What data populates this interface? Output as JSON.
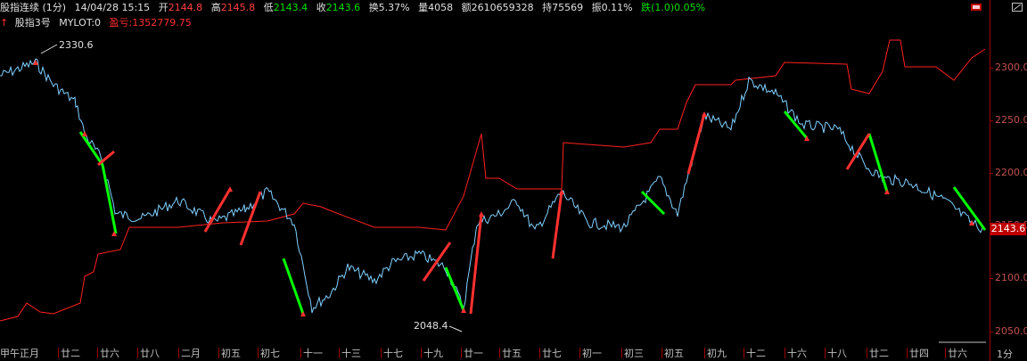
{
  "infobar": {
    "title": "股指连续 (1分)",
    "datetime": "14/04/28 15:15",
    "open_label": "开",
    "open_value": "2144.8",
    "high_label": "高",
    "high_value": "2145.8",
    "low_label": "低",
    "low_value": "2143.4",
    "close_label": "收",
    "close_value": "2143.6",
    "turnover": "换5.37%",
    "volume": "量4058",
    "amount": "额2610659328",
    "openint": "持75569",
    "amplitude": "振0.11%",
    "change": "跌(1.0)0.05%"
  },
  "subbar": {
    "system": "股指3号",
    "mylot": "MYLOT:0",
    "profit": "盈亏:1352779.75"
  },
  "markers": {
    "high": "2330.6",
    "low": "2048.4"
  },
  "yaxis": {
    "labels": [
      "2300.0",
      "2250.0",
      "2200.0",
      "2150.0",
      "2100.0",
      "2050.0"
    ],
    "last_price": "2143.6",
    "period": "1分"
  },
  "xaxis": {
    "labels": [
      "甲午正月",
      "廿二",
      "廿六",
      "廿八",
      "二月",
      "初五",
      "初七",
      "十一",
      "十三",
      "十七",
      "十九",
      "廿一",
      "廿五",
      "廿七",
      "初一",
      "初三",
      "初五",
      "初九",
      "十二",
      "十六",
      "十八",
      "廿二",
      "廿四",
      "廿六"
    ]
  },
  "colors": {
    "up": "#ff3030",
    "down": "#00ff00",
    "price": "#80d0ff",
    "equity": "#ff2020",
    "axis": "#9a0000"
  }
}
